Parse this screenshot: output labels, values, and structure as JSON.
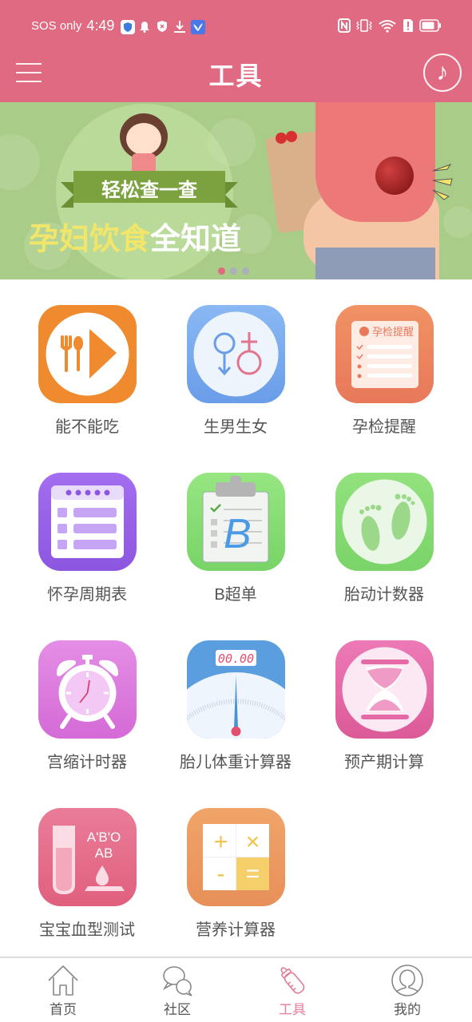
{
  "status_bar": {
    "carrier": "SOS only",
    "time": "4:49",
    "left_icons": [
      "shield-app-icon",
      "bell-icon",
      "shield-x-icon",
      "download-icon",
      "bird-app-icon"
    ],
    "right_icons": [
      "nfc-icon",
      "vibrate-icon",
      "wifi-6-icon",
      "sim-alert-icon",
      "battery-icon"
    ],
    "wifi_label": "6"
  },
  "header": {
    "title": "工具",
    "menu_icon": "hamburger-menu-icon",
    "music_icon": "music-note-icon",
    "music_glyph": "♪"
  },
  "banner": {
    "ribbon_text": "轻松查一查",
    "headline_yellow": "孕妇饮食",
    "headline_white": "全知道",
    "slides": 3,
    "active_slide": 1,
    "colors": {
      "background": "#a9cc88",
      "active_dot": "#e06a82",
      "inactive_dot": "#a9b0bc"
    }
  },
  "tools": [
    {
      "label": "能不能吃",
      "icon": "food-check-icon",
      "color": "#f08a2e"
    },
    {
      "label": "生男生女",
      "icon": "gender-icon",
      "color": "#7aaaf0"
    },
    {
      "label": "孕检提醒",
      "icon": "checkup-reminder-icon",
      "color": "#ee8a5e",
      "inner_text": "孕检提醒"
    },
    {
      "label": "怀孕周期表",
      "icon": "pregnancy-calendar-icon",
      "color": "#9a64e8"
    },
    {
      "label": "B超单",
      "icon": "ultrasound-report-icon",
      "color": "#86dc72",
      "inner_text": "B"
    },
    {
      "label": "胎动计数器",
      "icon": "footprints-icon",
      "color": "#8cdc78"
    },
    {
      "label": "宫缩计时器",
      "icon": "alarm-clock-icon",
      "color": "#d870d8"
    },
    {
      "label": "胎儿体重计算器",
      "icon": "weight-scale-icon",
      "color": "#5a9ee0",
      "inner_text": "00.00"
    },
    {
      "label": "预产期计算",
      "icon": "hourglass-icon",
      "color": "#e46aa6"
    },
    {
      "label": "宝宝血型测试",
      "icon": "blood-type-icon",
      "color": "#e66e8e",
      "inner_text_1": "A'B'O",
      "inner_text_2": "AB"
    },
    {
      "label": "营养计算器",
      "icon": "calculator-icon",
      "color": "#ec9a5c",
      "keys": [
        "+",
        "×",
        "-",
        "="
      ]
    }
  ],
  "bottom_nav": {
    "items": [
      {
        "label": "首页",
        "icon": "home-icon",
        "active": false
      },
      {
        "label": "社区",
        "icon": "chat-bubbles-icon",
        "active": false
      },
      {
        "label": "工具",
        "icon": "baby-bottle-icon",
        "active": true
      },
      {
        "label": "我的",
        "icon": "profile-icon",
        "active": false
      }
    ],
    "active_color": "#e27f98",
    "inactive_color": "#555555"
  }
}
